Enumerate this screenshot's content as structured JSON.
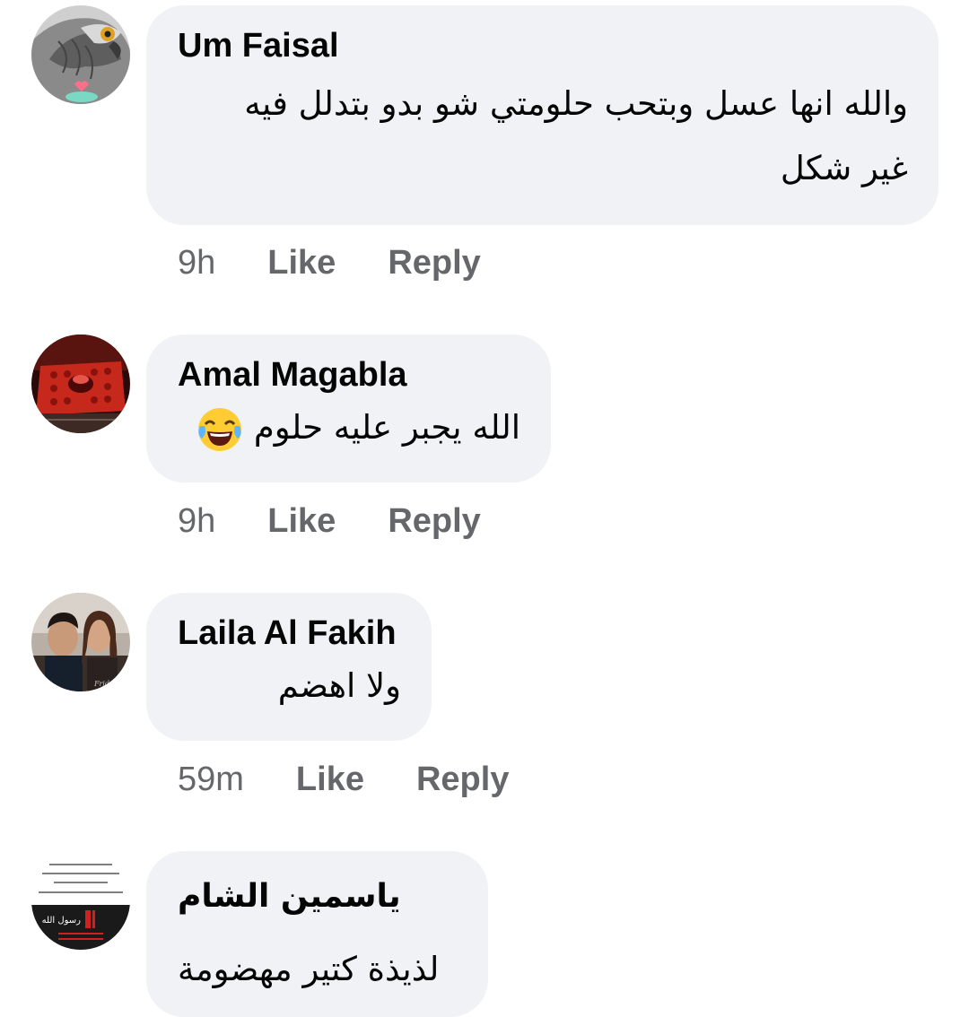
{
  "comments": [
    {
      "author": "Um Faisal",
      "text_line1": "والله انها عسل وبتحب حلومتي شو بدو بتدلل فيه",
      "text_line2": "غير شكل",
      "time": "9h",
      "like_label": "Like",
      "reply_label": "Reply",
      "avatar_icon": "eagle-avatar-icon"
    },
    {
      "author": "Amal Magabla",
      "text": "الله يجبر عليه حلوم",
      "emoji": "tears-of-joy-emoji-icon",
      "time": "9h",
      "like_label": "Like",
      "reply_label": "Reply",
      "avatar_icon": "red-tray-avatar-icon"
    },
    {
      "author": "Laila Al Fakih",
      "text": "ولا اهضم",
      "time": "59m",
      "like_label": "Like",
      "reply_label": "Reply",
      "avatar_icon": "couple-photo-avatar-icon"
    },
    {
      "author": "ياسمين الشام",
      "text": "لذيذة كتير مهضومة",
      "avatar_icon": "religious-text-avatar-icon",
      "avatar_text_lines": [
        "رسول الله"
      ]
    }
  ],
  "colors": {
    "bubble": "#f0f2f5",
    "text": "#050505",
    "meta": "#65676b"
  }
}
